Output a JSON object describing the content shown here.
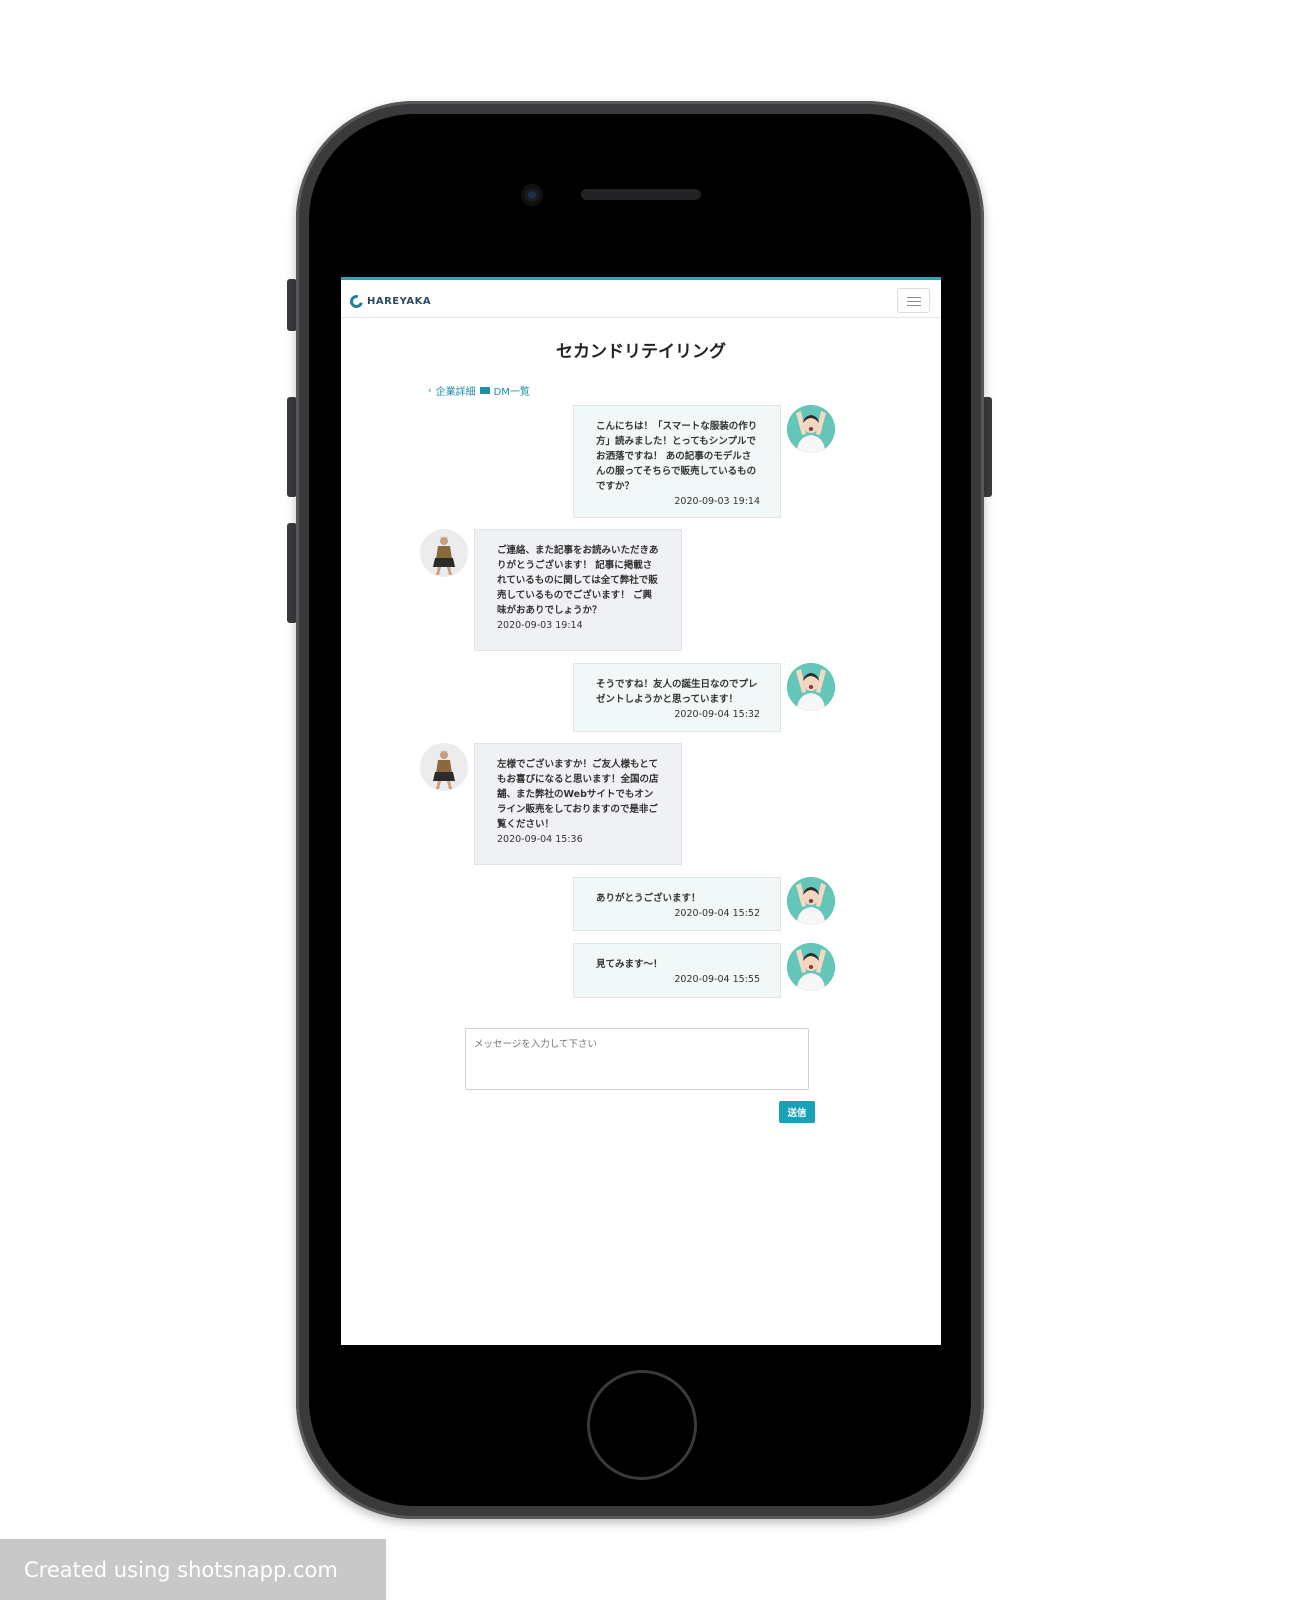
{
  "app": {
    "logo_text": "HAREYAKA",
    "page_title": "セカンドリテイリング"
  },
  "breadcrumb": {
    "back_label": "企業詳細",
    "dm_label": "DM一覧"
  },
  "messages": [
    {
      "sender": "me",
      "text": "こんにちは！「スマートな服装の作り方」読みました！とってもシンプルでお洒落ですね！ あの記事のモデルさんの服ってそちらで販売しているものですか？",
      "time": "2020-09-03 19:14"
    },
    {
      "sender": "them",
      "text": "ご連絡、また記事をお読みいただきありがとうございます！ 記事に掲載されているものに関しては全て弊社で販売しているものでございます！ ご興味がおありでしょうか？",
      "time": "2020-09-03 19:14"
    },
    {
      "sender": "me",
      "text": "そうですね！友人の誕生日なのでプレゼントしようかと思っています！",
      "time": "2020-09-04 15:32"
    },
    {
      "sender": "them",
      "text": "左様でございますか！ご友人様もとてもお喜びになると思います！全国の店舗、また弊社のWebサイトでもオンライン販売をしておりますので是非ご覧ください！",
      "time": "2020-09-04 15:36"
    },
    {
      "sender": "me",
      "text": "ありがとうございます！",
      "time": "2020-09-04 15:52"
    },
    {
      "sender": "me",
      "text": "見てみます〜！",
      "time": "2020-09-04 15:55"
    }
  ],
  "composer": {
    "placeholder": "メッセージを入力して下さい",
    "send_label": "送信"
  },
  "watermark": "Created using shotsnapp.com",
  "colors": {
    "accent": "#17a2b8",
    "my_bubble": "#f1f8f7",
    "their_bubble": "#f0f1f4"
  }
}
